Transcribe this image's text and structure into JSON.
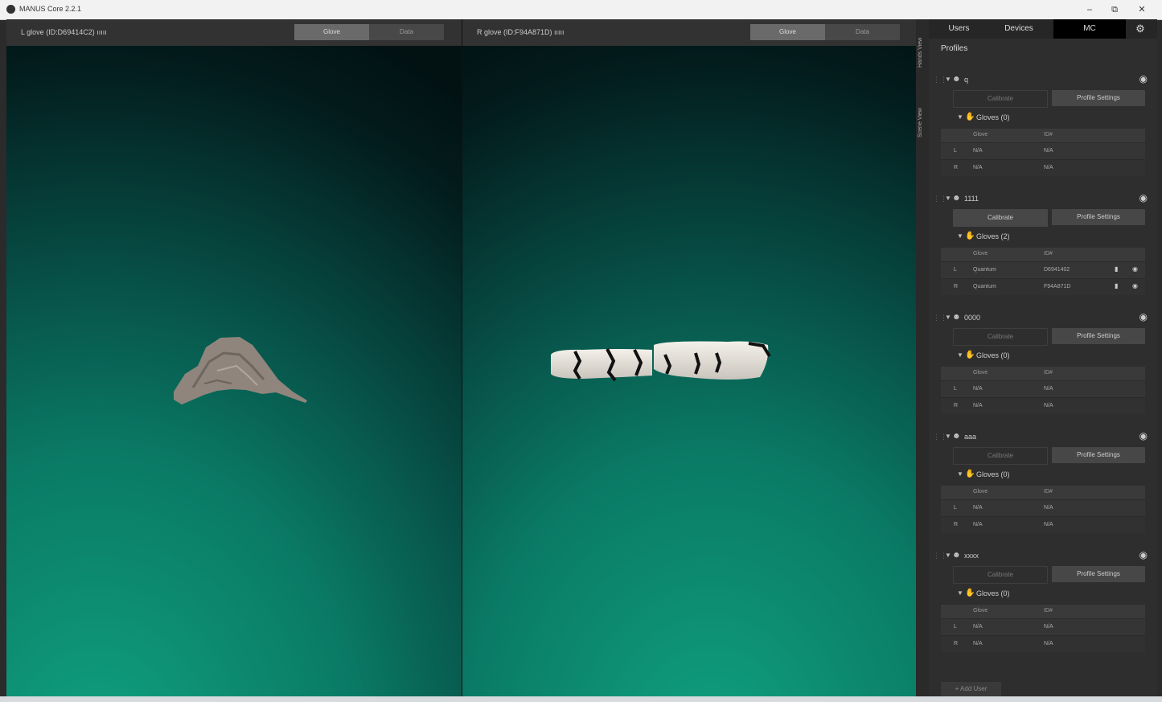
{
  "window": {
    "title": "MANUS Core 2.2.1",
    "minimize": "–",
    "maximize": "⧉",
    "close": "✕"
  },
  "viewports": {
    "left": {
      "title": "L glove (ID:D69414C2) ııııı",
      "btn_glove": "Glove",
      "btn_data": "Data"
    },
    "right": {
      "title": "R glove (ID:F94A871D) ııııı",
      "btn_glove": "Glove",
      "btn_data": "Data"
    }
  },
  "side_tabs": {
    "hands_view": "Hands View",
    "scene_view": "Scene View"
  },
  "panel": {
    "tabs": {
      "users": "Users",
      "devices": "Devices",
      "mc": "MC",
      "settings_icon": "⚙"
    },
    "profiles_heading": "Profiles",
    "table_headers": {
      "glove": "Glove",
      "id": "ID#"
    },
    "add_user": "+ Add User",
    "profiles": [
      {
        "name": "q",
        "calibrate": "Calibrate",
        "profile_settings": "Profile Settings",
        "gloves_label": "Gloves (0)",
        "rows": [
          {
            "side": "L",
            "glove": "N/A",
            "id": "N/A"
          },
          {
            "side": "R",
            "glove": "N/A",
            "id": "N/A"
          }
        ]
      },
      {
        "name": "1111",
        "calibrate": "Calibrate",
        "profile_settings": "Profile Settings",
        "gloves_label": "Gloves (2)",
        "rows": [
          {
            "side": "L",
            "glove": "Quantum",
            "id": "D6941402"
          },
          {
            "side": "R",
            "glove": "Quantum",
            "id": "F94A871D"
          }
        ]
      },
      {
        "name": "0000",
        "calibrate": "Calibrate",
        "profile_settings": "Profile Settings",
        "gloves_label": "Gloves (0)",
        "rows": [
          {
            "side": "L",
            "glove": "N/A",
            "id": "N/A"
          },
          {
            "side": "R",
            "glove": "N/A",
            "id": "N/A"
          }
        ]
      },
      {
        "name": "aaa",
        "calibrate": "Calibrate",
        "profile_settings": "Profile Settings",
        "gloves_label": "Gloves (0)",
        "rows": [
          {
            "side": "L",
            "glove": "N/A",
            "id": "N/A"
          },
          {
            "side": "R",
            "glove": "N/A",
            "id": "N/A"
          }
        ]
      },
      {
        "name": "xxxx",
        "calibrate": "Calibrate",
        "profile_settings": "Profile Settings",
        "gloves_label": "Gloves (0)",
        "rows": [
          {
            "side": "L",
            "glove": "N/A",
            "id": "N/A"
          },
          {
            "side": "R",
            "glove": "N/A",
            "id": "N/A"
          }
        ]
      }
    ]
  },
  "colors": {
    "accent_teal": "#0f9a7a",
    "panel_bg": "#2e2e2e",
    "active_tab": "#000000"
  }
}
